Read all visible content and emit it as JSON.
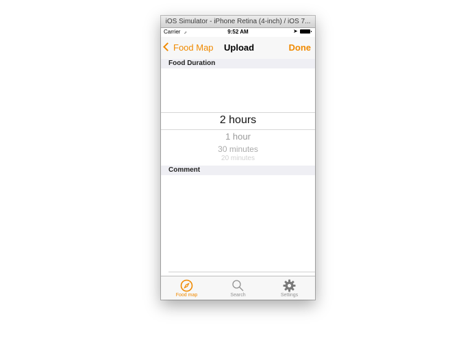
{
  "window": {
    "title": "iOS Simulator - iPhone Retina (4-inch) / iOS 7..."
  },
  "status_bar": {
    "carrier": "Carrier",
    "time": "9:52 AM"
  },
  "nav": {
    "back_label": "Food Map",
    "title": "Upload",
    "done_label": "Done"
  },
  "sections": {
    "duration_header": "Food Duration",
    "comment_header": "Comment"
  },
  "picker": {
    "selected": "2 hours",
    "below": [
      "1 hour",
      "30 minutes",
      "20 minutes"
    ]
  },
  "tabs": [
    {
      "label": "Food map",
      "icon": "compass-icon",
      "active": true
    },
    {
      "label": "Search",
      "icon": "search-icon",
      "active": false
    },
    {
      "label": "Settings",
      "icon": "gear-icon",
      "active": false
    }
  ],
  "colors": {
    "accent": "#f08a00",
    "inactive": "#929292",
    "section_bg": "#efeff4"
  }
}
